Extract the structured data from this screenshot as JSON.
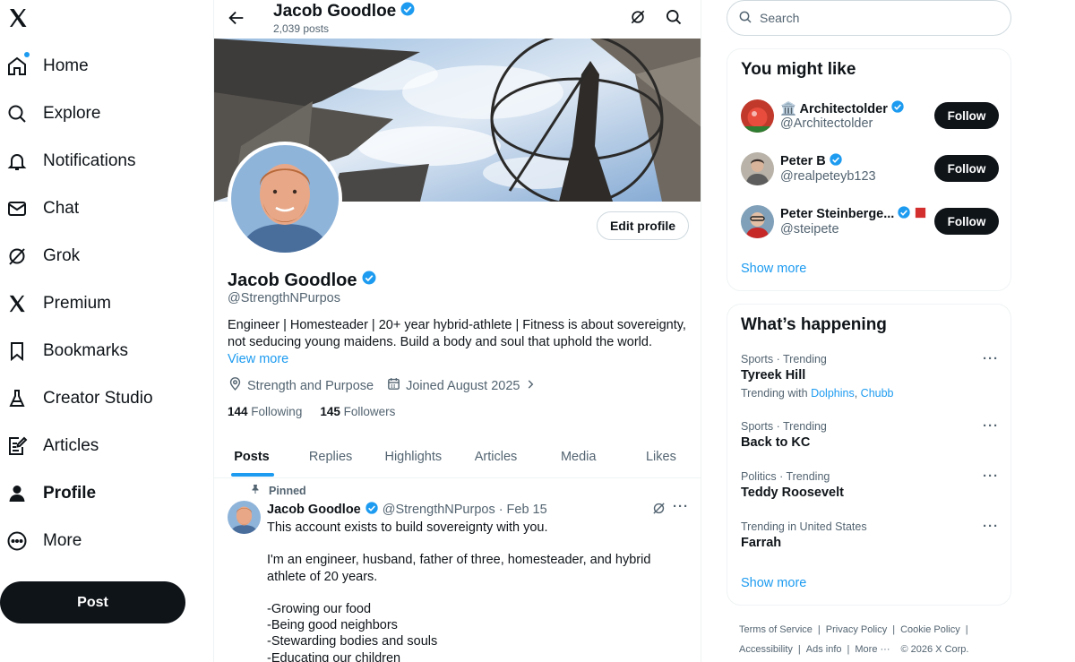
{
  "nav": {
    "items": [
      {
        "label": "Home",
        "icon": "home-icon"
      },
      {
        "label": "Explore",
        "icon": "search-icon"
      },
      {
        "label": "Notifications",
        "icon": "bell-icon"
      },
      {
        "label": "Chat",
        "icon": "mail-icon"
      },
      {
        "label": "Grok",
        "icon": "grok-icon"
      },
      {
        "label": "Premium",
        "icon": "x-logo-icon"
      },
      {
        "label": "Bookmarks",
        "icon": "bookmark-icon"
      },
      {
        "label": "Creator Studio",
        "icon": "flask-icon"
      },
      {
        "label": "Articles",
        "icon": "article-icon"
      },
      {
        "label": "Profile",
        "icon": "person-icon",
        "active": true
      },
      {
        "label": "More",
        "icon": "more-circle-icon"
      }
    ],
    "post_label": "Post"
  },
  "header": {
    "name": "Jacob Goodloe",
    "posts_count": "2,039 posts"
  },
  "profile": {
    "edit_label": "Edit profile",
    "name": "Jacob Goodloe",
    "handle": "@StrengthNPurpos",
    "bio_line1": "Engineer | Homesteader | 20+ year hybrid-athlete | Fitness is about sovereignty,",
    "bio_line2": "not seducing young maidens. Build a body and soul that uphold the world.",
    "view_more": "View more",
    "location": "Strength and Purpose",
    "joined": "Joined August 2025",
    "following_count": "144",
    "following_label": "Following",
    "followers_count": "145",
    "followers_label": "Followers"
  },
  "tabs": [
    "Posts",
    "Replies",
    "Highlights",
    "Articles",
    "Media",
    "Likes"
  ],
  "pinned_post": {
    "pinned_label": "Pinned",
    "name": "Jacob Goodloe",
    "handle": "@StrengthNPurpos",
    "dot": "·",
    "date": "Feb 15",
    "lines": [
      "This account exists to build sovereignty with you.",
      "",
      "I'm an engineer, husband, father of three, homesteader, and hybrid athlete of 20 years.",
      "",
      "-Growing our food",
      "-Being good neighbors",
      "-Stewarding bodies and souls",
      "-Educating our children"
    ]
  },
  "search": {
    "placeholder": "Search"
  },
  "who_to_follow": {
    "title": "You might like",
    "follow_label": "Follow",
    "accounts": [
      {
        "name": "🏛️ Architectolder",
        "handle": "@Architectolder"
      },
      {
        "name": "Peter B",
        "handle": "@realpeteyb123"
      },
      {
        "name": "Peter Steinberge...",
        "handle": "@steipete"
      }
    ],
    "show_more": "Show more"
  },
  "trends": {
    "title": "What’s happening",
    "items": [
      {
        "context": "Sports · Trending",
        "topic": "Tyreek Hill",
        "with_label": "Trending with",
        "with_links": [
          "Dolphins",
          "Chubb"
        ],
        "with_sep": ","
      },
      {
        "context": "Sports · Trending",
        "topic": "Back to KC"
      },
      {
        "context": "Politics · Trending",
        "topic": "Teddy Roosevelt"
      },
      {
        "context": "Trending in United States",
        "topic": "Farrah"
      }
    ],
    "more_glyph": "···",
    "show_more": "Show more"
  },
  "footer": {
    "links_row1": [
      "Terms of Service",
      "Privacy Policy",
      "Cookie Policy"
    ],
    "links_row2": [
      "Accessibility",
      "Ads info",
      "More ···"
    ],
    "copyright": "© 2026 X Corp.",
    "sep": "|"
  },
  "colors": {
    "accent": "#1d9bf0",
    "text": "#0f1419",
    "muted": "#536471",
    "border": "#eff3f4",
    "button_dark": "#0f1419"
  }
}
